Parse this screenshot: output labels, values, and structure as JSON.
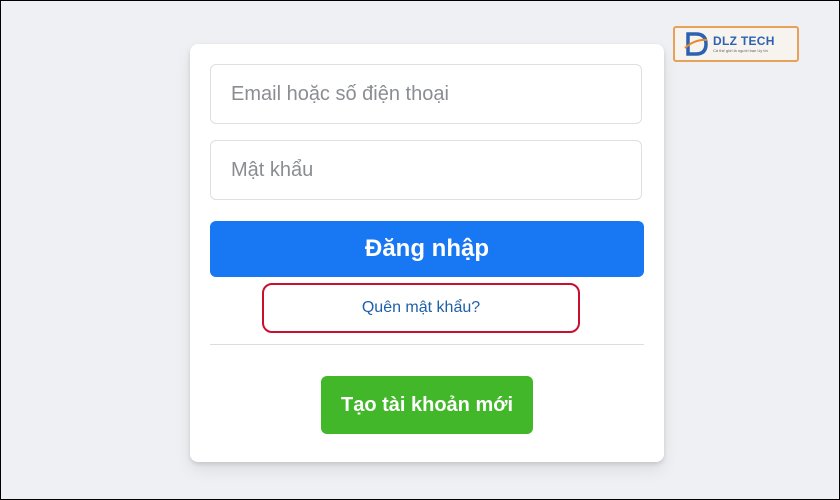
{
  "form": {
    "email_placeholder": "Email hoặc số điện thoại",
    "password_placeholder": "Mật khẩu",
    "login_label": "Đăng nhập",
    "forgot_label": "Quên mật khẩu?",
    "create_label": "Tạo tài khoản mới"
  },
  "logo": {
    "title": "DLZ TECH",
    "tagline": "Cả thế giới là người bạn Uy tín",
    "icon": "dlz-tech-logo-icon"
  },
  "colors": {
    "login_button": "#1877f2",
    "create_button": "#42b72a",
    "highlight_border": "#c8102e",
    "background": "#eef0f3"
  }
}
